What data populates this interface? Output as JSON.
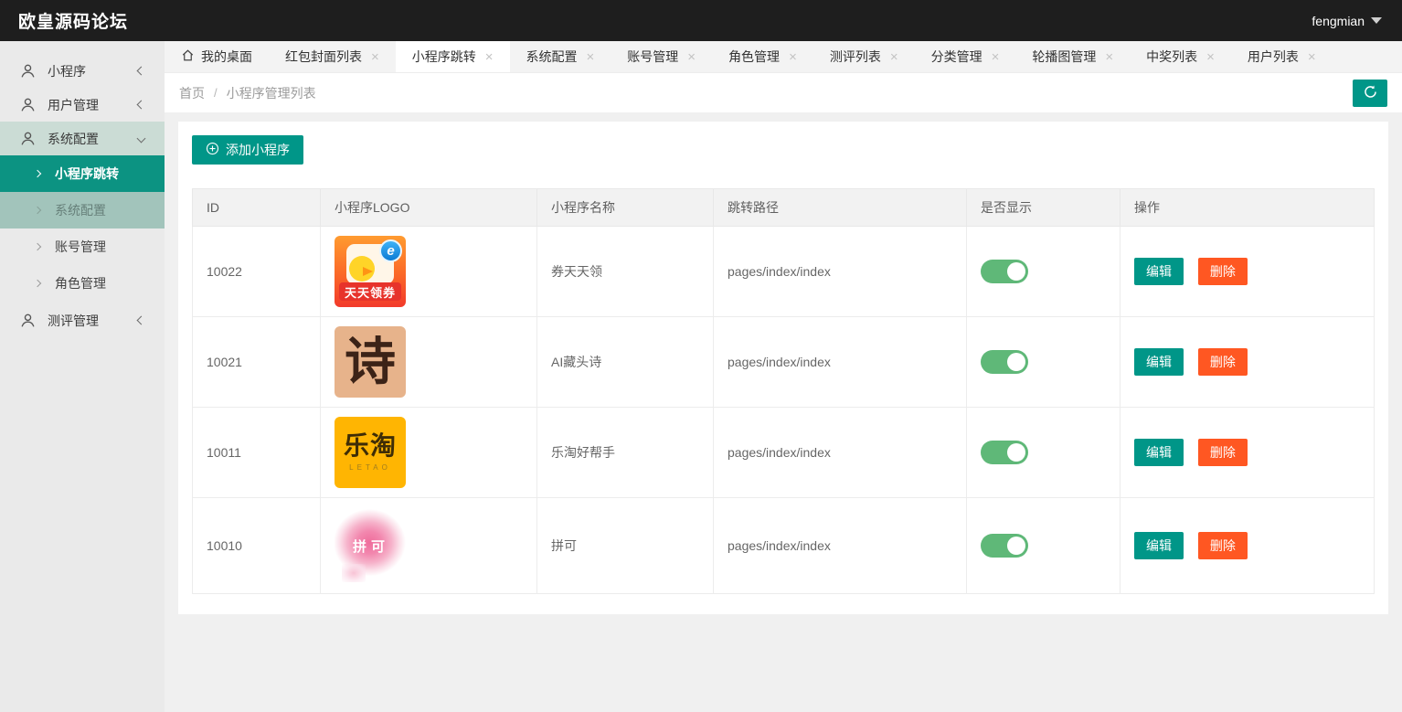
{
  "header": {
    "title": "欧皇源码论坛",
    "username": "fengmian"
  },
  "sidebar": {
    "items": [
      {
        "label": "小程序"
      },
      {
        "label": "用户管理"
      },
      {
        "label": "系统配置"
      },
      {
        "label": "测评管理"
      }
    ],
    "submenu": [
      {
        "label": "小程序跳转"
      },
      {
        "label": "系统配置"
      },
      {
        "label": "账号管理"
      },
      {
        "label": "角色管理"
      }
    ]
  },
  "tabs": [
    {
      "label": "我的桌面"
    },
    {
      "label": "红包封面列表"
    },
    {
      "label": "小程序跳转"
    },
    {
      "label": "系统配置"
    },
    {
      "label": "账号管理"
    },
    {
      "label": "角色管理"
    },
    {
      "label": "测评列表"
    },
    {
      "label": "分类管理"
    },
    {
      "label": "轮播图管理"
    },
    {
      "label": "中奖列表"
    },
    {
      "label": "用户列表"
    }
  ],
  "breadcrumb": {
    "home": "首页",
    "separator": "/",
    "current": "小程序管理列表"
  },
  "toolbar": {
    "add_label": "添加小程序"
  },
  "table": {
    "columns": [
      "ID",
      "小程序LOGO",
      "小程序名称",
      "跳转路径",
      "是否显示",
      "操作"
    ],
    "edit_label": "编辑",
    "delete_label": "删除",
    "rows": [
      {
        "id": "10022",
        "name": "券天天领",
        "path": "pages/index/index",
        "visible": true
      },
      {
        "id": "10021",
        "name": "AI藏头诗",
        "path": "pages/index/index",
        "visible": true
      },
      {
        "id": "10011",
        "name": "乐淘好帮手",
        "path": "pages/index/index",
        "visible": true
      },
      {
        "id": "10010",
        "name": "拼可",
        "path": "pages/index/index",
        "visible": true
      }
    ]
  },
  "logos": {
    "coupon": {
      "banner": "天天领券",
      "badge": "e"
    },
    "poem": {
      "glyph": "诗"
    },
    "letao": {
      "title": "乐淘",
      "subtitle": "LETAO"
    },
    "pinke": {
      "title": "拼可"
    }
  },
  "icons": {
    "home": "home-icon",
    "close": "close-icon",
    "refresh": "refresh-icon",
    "plus": "plus-circle-icon",
    "user": "person-icon",
    "caret": "caret-down-icon"
  },
  "colors": {
    "accent": "#009688",
    "danger": "#ff5722",
    "switch_on": "#5FB878",
    "active_menu": "#0c9382",
    "topbar": "#1e1e1e"
  }
}
